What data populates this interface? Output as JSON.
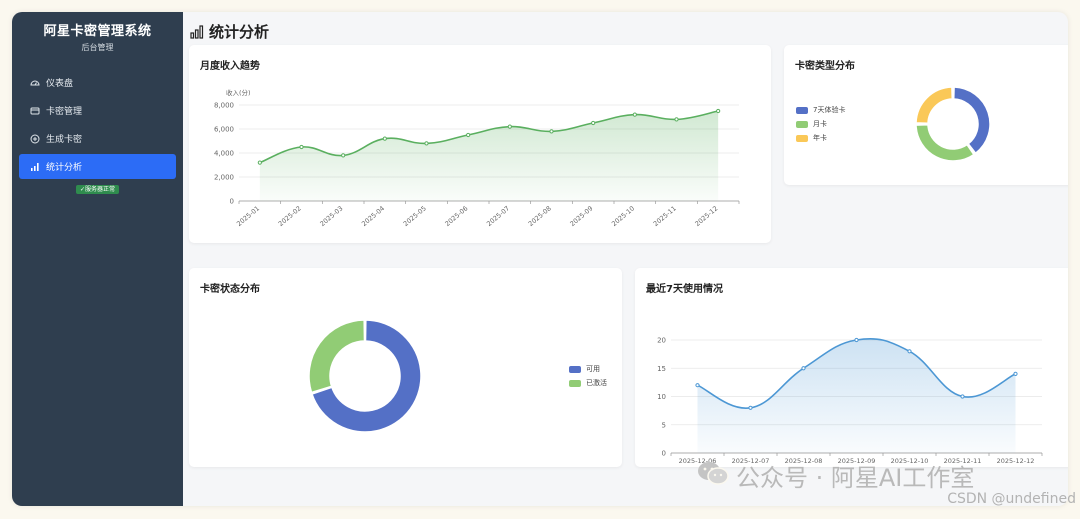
{
  "sidebar": {
    "brand_title": "阿星卡密管理系统",
    "brand_subtitle": "后台管理",
    "items": [
      {
        "label": "仪表盘",
        "icon": "dashboard-icon"
      },
      {
        "label": "卡密管理",
        "icon": "card-icon"
      },
      {
        "label": "生成卡密",
        "icon": "plus-circle-icon"
      },
      {
        "label": "统计分析",
        "icon": "bar-chart-icon",
        "active": true
      }
    ],
    "status_badge": "✓服务器正常"
  },
  "page": {
    "title": "统计分析"
  },
  "colors": {
    "sidebar_bg": "#2f3e4f",
    "accent": "#2c6cf6",
    "green": "#5aaf5f",
    "blue": "#5470c6",
    "light_green": "#91cc75",
    "yellow": "#fac858",
    "line_blue": "#4c97d4"
  },
  "chart_data": [
    {
      "id": "monthly",
      "type": "area",
      "title": "月度收入趋势",
      "ylabel": "收入(分)",
      "categories": [
        "2025-01",
        "2025-02",
        "2025-03",
        "2025-04",
        "2025-05",
        "2025-06",
        "2025-07",
        "2025-08",
        "2025-09",
        "2025-10",
        "2025-11",
        "2025-12"
      ],
      "values": [
        3200,
        4500,
        3800,
        5200,
        4800,
        5500,
        6200,
        5800,
        6500,
        7200,
        6800,
        7500
      ],
      "ylim": [
        0,
        8000
      ],
      "yticks": [
        "0",
        "2,000",
        "4,000",
        "6,000",
        "8,000"
      ],
      "grid": true
    },
    {
      "id": "type",
      "type": "pie",
      "title": "卡密类型分布",
      "labels": [
        "7天体验卡",
        "月卡",
        "年卡"
      ],
      "values": [
        40,
        35,
        25
      ],
      "legend": "left"
    },
    {
      "id": "status",
      "type": "pie",
      "title": "卡密状态分布",
      "labels": [
        "可用",
        "已激活"
      ],
      "values": [
        70,
        30
      ],
      "legend": "right"
    },
    {
      "id": "usage",
      "type": "area",
      "title": "最近7天使用情况",
      "categories": [
        "2025-12-06",
        "2025-12-07",
        "2025-12-08",
        "2025-12-09",
        "2025-12-10",
        "2025-12-11",
        "2025-12-12"
      ],
      "values": [
        12,
        8,
        15,
        20,
        18,
        10,
        14
      ],
      "ylim": [
        0,
        20
      ],
      "yticks": [
        "0",
        "5",
        "10",
        "15",
        "20"
      ],
      "grid": true
    }
  ],
  "watermark": {
    "text": "公众号 · 阿星AI工作室",
    "csdn": "CSDN @undefined"
  }
}
